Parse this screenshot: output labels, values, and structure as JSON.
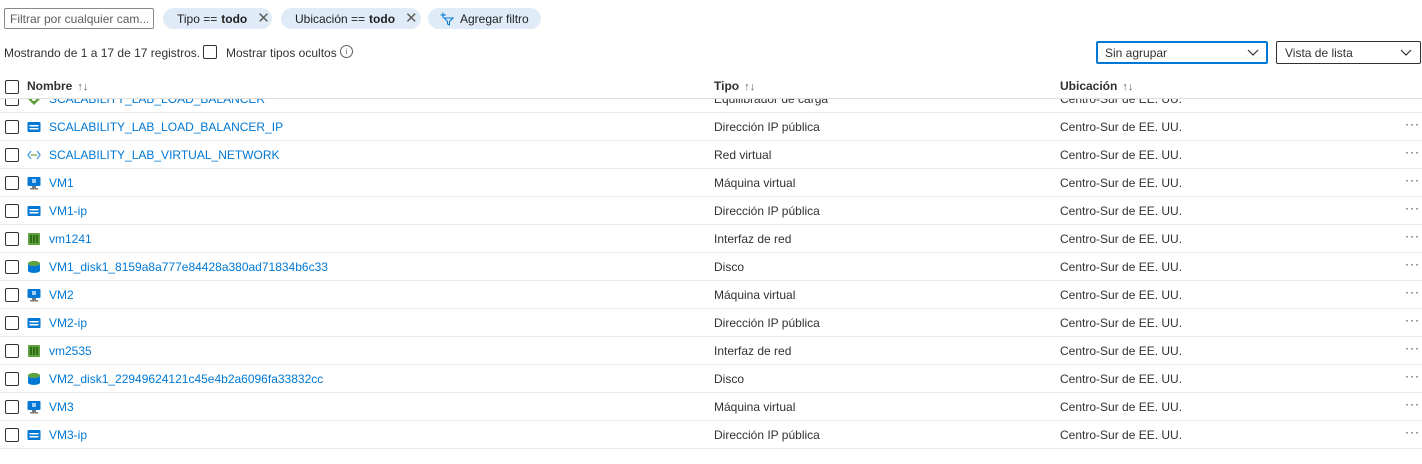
{
  "filter_bar": {
    "search_placeholder": "Filtrar por cualquier cam...",
    "pill_type_label": "Tipo ==",
    "pill_type_value": "todo",
    "pill_location_label": "Ubicación ==",
    "pill_location_value": "todo",
    "add_filter_label": "Agregar filtro"
  },
  "status": {
    "showing_text": "Mostrando de 1 a 17 de 17 registros.",
    "show_hidden_label": "Mostrar tipos ocultos",
    "info_glyph": "i"
  },
  "view_controls": {
    "grouping_value": "Sin agrupar",
    "view_value": "Vista de lista"
  },
  "table": {
    "columns": {
      "name": "Nombre",
      "type": "Tipo",
      "location": "Ubicación",
      "sort_glyph": "↑↓"
    },
    "rows": [
      {
        "name": "SCALABILITY_LAB_LOAD_BALANCER",
        "type": "Equilibrador de carga",
        "location": "Centro-Sur de EE. UU.",
        "icon": "load-balancer-icon",
        "color": "#5ea13c"
      },
      {
        "name": "SCALABILITY_LAB_LOAD_BALANCER_IP",
        "type": "Dirección IP pública",
        "location": "Centro-Sur de EE. UU.",
        "icon": "public-ip-icon",
        "color": "#0078d4"
      },
      {
        "name": "SCALABILITY_LAB_VIRTUAL_NETWORK",
        "type": "Red virtual",
        "location": "Centro-Sur de EE. UU.",
        "icon": "virtual-network-icon",
        "color": "#50a0e6"
      },
      {
        "name": "VM1",
        "type": "Máquina virtual",
        "location": "Centro-Sur de EE. UU.",
        "icon": "virtual-machine-icon",
        "color": "#0078d4"
      },
      {
        "name": "VM1-ip",
        "type": "Dirección IP pública",
        "location": "Centro-Sur de EE. UU.",
        "icon": "public-ip-icon",
        "color": "#0078d4"
      },
      {
        "name": "vm1241",
        "type": "Interfaz de red",
        "location": "Centro-Sur de EE. UU.",
        "icon": "network-interface-icon",
        "color": "#5ea13c"
      },
      {
        "name": "VM1_disk1_8159a8a777e84428a380ad71834b6c33",
        "type": "Disco",
        "location": "Centro-Sur de EE. UU.",
        "icon": "disk-icon",
        "color": "#0078d4"
      },
      {
        "name": "VM2",
        "type": "Máquina virtual",
        "location": "Centro-Sur de EE. UU.",
        "icon": "virtual-machine-icon",
        "color": "#0078d4"
      },
      {
        "name": "VM2-ip",
        "type": "Dirección IP pública",
        "location": "Centro-Sur de EE. UU.",
        "icon": "public-ip-icon",
        "color": "#0078d4"
      },
      {
        "name": "vm2535",
        "type": "Interfaz de red",
        "location": "Centro-Sur de EE. UU.",
        "icon": "network-interface-icon",
        "color": "#5ea13c"
      },
      {
        "name": "VM2_disk1_22949624121c45e4b2a6096fa33832cc",
        "type": "Disco",
        "location": "Centro-Sur de EE. UU.",
        "icon": "disk-icon",
        "color": "#0078d4"
      },
      {
        "name": "VM3",
        "type": "Máquina virtual",
        "location": "Centro-Sur de EE. UU.",
        "icon": "virtual-machine-icon",
        "color": "#0078d4"
      },
      {
        "name": "VM3-ip",
        "type": "Dirección IP pública",
        "location": "Centro-Sur de EE. UU.",
        "icon": "public-ip-icon",
        "color": "#0078d4"
      }
    ],
    "more_glyph": "···"
  },
  "colors": {
    "link": "#0078d4",
    "pill_bg": "#dfecf8",
    "focus": "#0078d4"
  }
}
